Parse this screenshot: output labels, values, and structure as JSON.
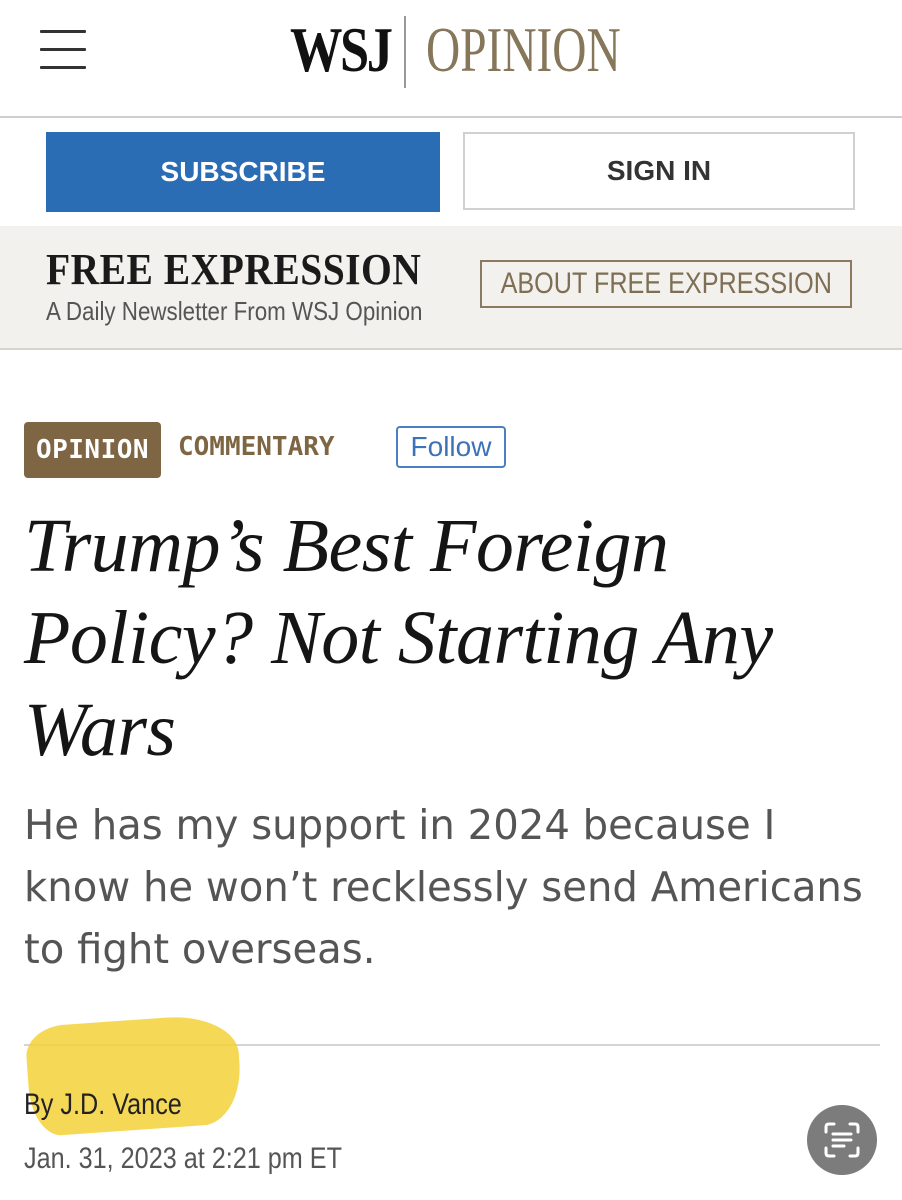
{
  "header": {
    "logo_wsj": "WSJ",
    "logo_opinion": "OPINION",
    "menu_icon": "hamburger-menu-icon"
  },
  "account": {
    "subscribe_label": "SUBSCRIBE",
    "signin_label": "SIGN IN"
  },
  "newsletter": {
    "title": "FREE EXPRESSION",
    "subtitle": "A Daily Newsletter From WSJ Opinion",
    "about_label": "ABOUT FREE EXPRESSION"
  },
  "article": {
    "badge": "OPINION",
    "section": "COMMENTARY",
    "follow_label": "Follow",
    "headline": "Trump’s Best Foreign Policy? Not Starting Any Wars",
    "dek": "He has my support in 2024 because I know he won’t recklessly send Americans to fight overseas.",
    "byline_prefix": "By ",
    "author": "J.D. Vance",
    "timestamp": "Jan. 31, 2023 at 2:21 pm ET"
  },
  "overlay": {
    "scan_icon": "live-text-scan-icon"
  },
  "colors": {
    "subscribe_blue": "#2a6db5",
    "opinion_brown": "#7e6543",
    "logo_gold": "#86765a",
    "highlight_yellow": "#f5d13a",
    "follow_blue": "#3c73b8"
  }
}
